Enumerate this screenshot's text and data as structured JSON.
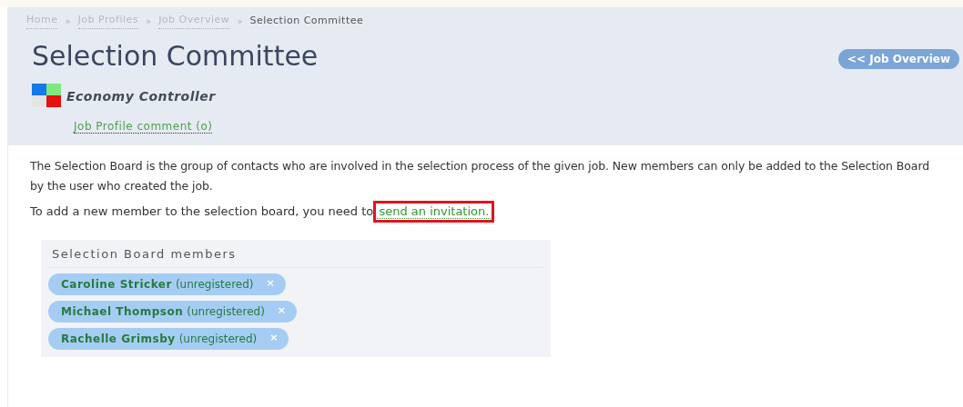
{
  "breadcrumb": [
    {
      "label": "Home",
      "current": false
    },
    {
      "label": "Job Profiles",
      "current": false
    },
    {
      "label": "Job Overview",
      "current": false
    },
    {
      "label": "Selection Committee",
      "current": true
    }
  ],
  "breadcrumb_separator": "»",
  "title": "Selection Committee",
  "back_button": "<< Job Overview",
  "job": {
    "name": "Economy Controller",
    "comment_link": "Job Profile comment (o)"
  },
  "description": "The Selection Board is the group of contacts who are involved in the selection process of the given job. New members can only be added to the Selection Board by the user who created the job.",
  "invite": {
    "text": "To add a new member to the selection board, you need to",
    "link": "send an invitation.",
    "highlighted": true
  },
  "board": {
    "title": "Selection Board members",
    "members": [
      {
        "name": "Caroline Stricker",
        "status": "(unregistered)",
        "remove": "×"
      },
      {
        "name": "Michael Thompson",
        "status": "(unregistered)",
        "remove": "×"
      },
      {
        "name": "Rachelle Grimsby",
        "status": "(unregistered)",
        "remove": "×"
      }
    ]
  }
}
